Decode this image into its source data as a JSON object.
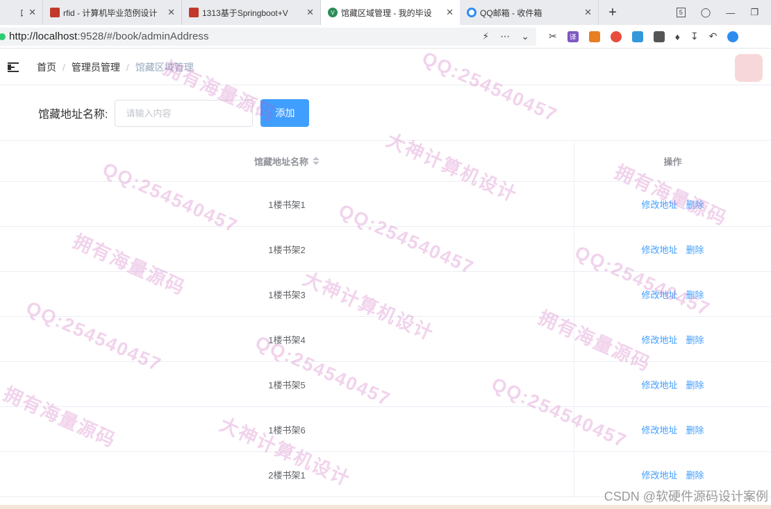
{
  "browser": {
    "tabs": [
      {
        "label": "口 千",
        "icon": "pale",
        "active": false
      },
      {
        "label": "rfid - 计算机毕业范例设计",
        "icon": "red",
        "active": false
      },
      {
        "label": "1313基于Springboot+V",
        "icon": "red",
        "active": false
      },
      {
        "label": "馆藏区域管理 - 我的毕设",
        "icon": "vue",
        "active": true
      },
      {
        "label": "QQ邮箱 - 收件箱",
        "icon": "qq",
        "active": false
      }
    ],
    "close_glyph": "✕",
    "new_tab_glyph": "+",
    "tab_count": "5",
    "url_host": "http://localhost",
    "url_rest": ":9528/#/book/adminAddress"
  },
  "header": {
    "breadcrumbs": [
      "首页",
      "管理员管理",
      "馆藏区域管理"
    ],
    "separator": "/"
  },
  "filter": {
    "label": "馆藏地址名称:",
    "placeholder": "请输入内容",
    "value": "",
    "add_button": "添加"
  },
  "table": {
    "columns": {
      "name": "馆藏地址名称",
      "ops": "操作"
    },
    "edit_label": "修改地址",
    "delete_label": "删除",
    "rows": [
      "1楼书架1",
      "1楼书架2",
      "1楼书架3",
      "1楼书架4",
      "1楼书架5",
      "1楼书架6",
      "2楼书架1"
    ]
  },
  "watermarks": {
    "qq": "QQ:254540457",
    "own": "拥有海量源码",
    "design": "大神计算机设计",
    "csdn": "CSDN @软硬件源码设计案例"
  },
  "colors": {
    "primary": "#409eff",
    "watermark": "#c850b4"
  }
}
